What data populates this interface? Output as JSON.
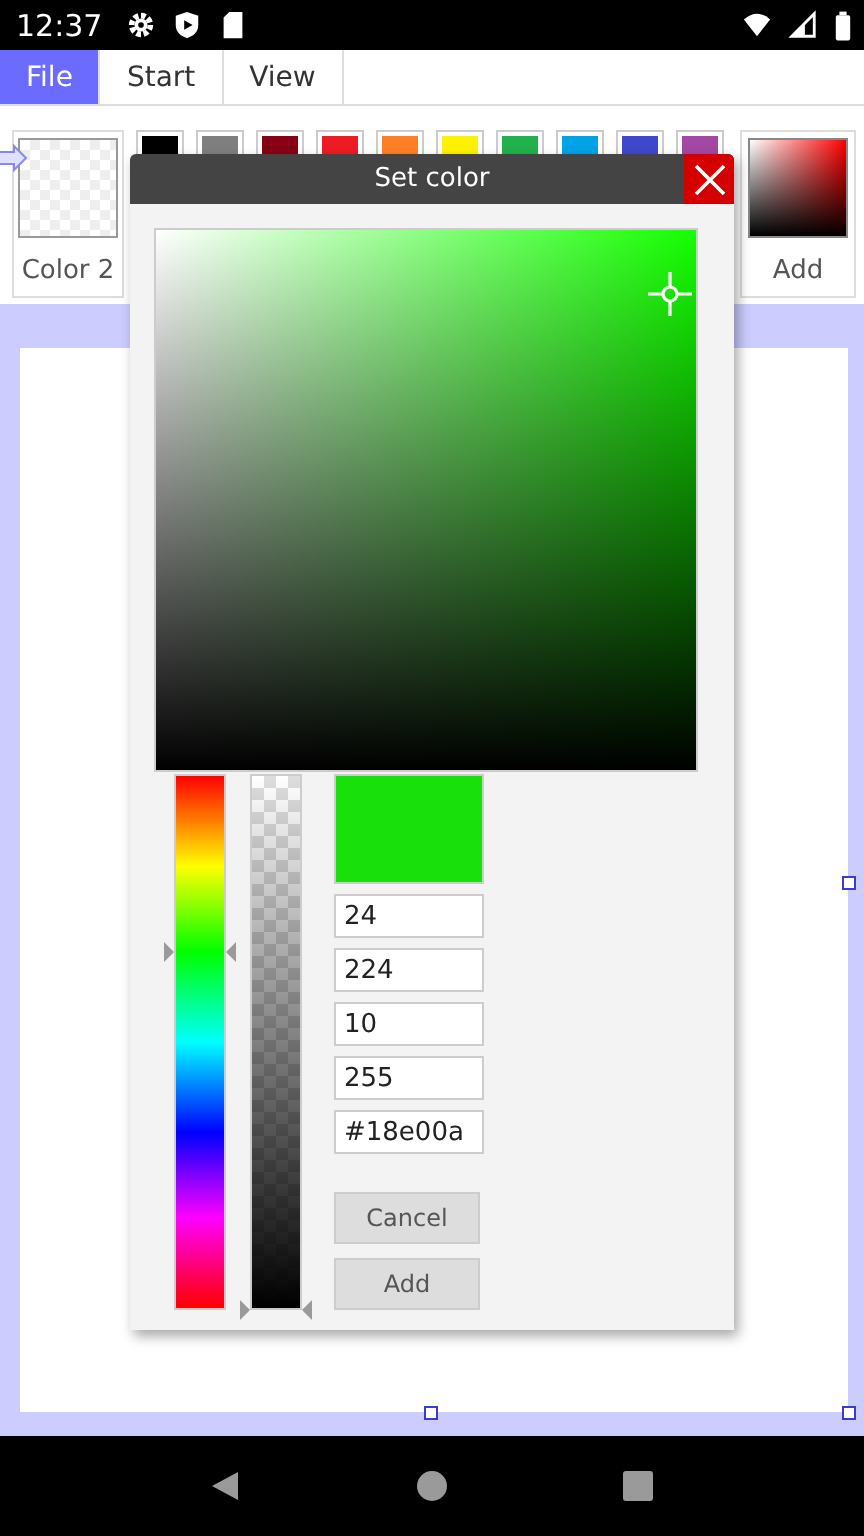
{
  "status_bar": {
    "time": "12:37"
  },
  "tabs": [
    {
      "label": "File",
      "selected": true
    },
    {
      "label": "Start",
      "selected": false
    },
    {
      "label": "View",
      "selected": false
    }
  ],
  "ribbon": {
    "color_slot": {
      "label": "Color 2"
    },
    "palette": [
      {
        "color": "#000000"
      },
      {
        "color": "#7f7f7f"
      },
      {
        "color": "#880015"
      },
      {
        "color": "#ed1c24"
      },
      {
        "color": "#ff7f27"
      },
      {
        "color": "#fff200"
      },
      {
        "color": "#22b14c"
      },
      {
        "color": "#00a2e8"
      },
      {
        "color": "#3f48cc"
      },
      {
        "color": "#a349a4"
      }
    ],
    "add": {
      "label": "Add"
    }
  },
  "dialog": {
    "title": "Set color",
    "preview": {
      "color": "#18e00a"
    },
    "fields": [
      {
        "value": "24"
      },
      {
        "value": "224"
      },
      {
        "value": "10"
      },
      {
        "value": "255"
      },
      {
        "value": "#18e00a"
      }
    ],
    "buttons": [
      "Cancel",
      "Add"
    ]
  }
}
